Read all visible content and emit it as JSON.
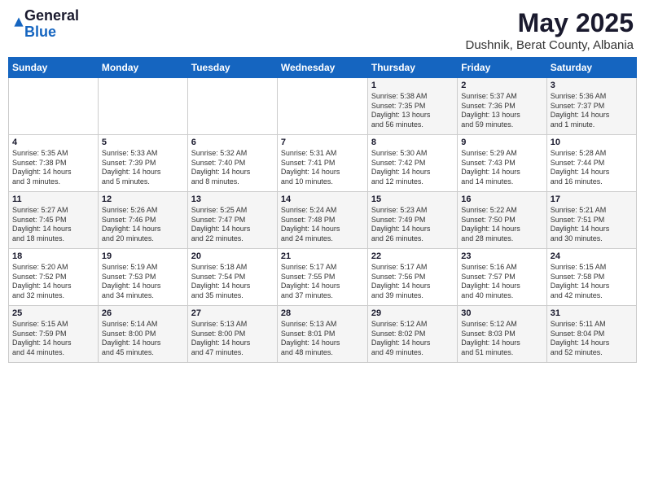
{
  "header": {
    "logo_general": "General",
    "logo_blue": "Blue",
    "month_year": "May 2025",
    "location": "Dushnik, Berat County, Albania"
  },
  "calendar": {
    "days_of_week": [
      "Sunday",
      "Monday",
      "Tuesday",
      "Wednesday",
      "Thursday",
      "Friday",
      "Saturday"
    ],
    "weeks": [
      [
        {
          "day": "",
          "info": ""
        },
        {
          "day": "",
          "info": ""
        },
        {
          "day": "",
          "info": ""
        },
        {
          "day": "",
          "info": ""
        },
        {
          "day": "1",
          "info": "Sunrise: 5:38 AM\nSunset: 7:35 PM\nDaylight: 13 hours\nand 56 minutes."
        },
        {
          "day": "2",
          "info": "Sunrise: 5:37 AM\nSunset: 7:36 PM\nDaylight: 13 hours\nand 59 minutes."
        },
        {
          "day": "3",
          "info": "Sunrise: 5:36 AM\nSunset: 7:37 PM\nDaylight: 14 hours\nand 1 minute."
        }
      ],
      [
        {
          "day": "4",
          "info": "Sunrise: 5:35 AM\nSunset: 7:38 PM\nDaylight: 14 hours\nand 3 minutes."
        },
        {
          "day": "5",
          "info": "Sunrise: 5:33 AM\nSunset: 7:39 PM\nDaylight: 14 hours\nand 5 minutes."
        },
        {
          "day": "6",
          "info": "Sunrise: 5:32 AM\nSunset: 7:40 PM\nDaylight: 14 hours\nand 8 minutes."
        },
        {
          "day": "7",
          "info": "Sunrise: 5:31 AM\nSunset: 7:41 PM\nDaylight: 14 hours\nand 10 minutes."
        },
        {
          "day": "8",
          "info": "Sunrise: 5:30 AM\nSunset: 7:42 PM\nDaylight: 14 hours\nand 12 minutes."
        },
        {
          "day": "9",
          "info": "Sunrise: 5:29 AM\nSunset: 7:43 PM\nDaylight: 14 hours\nand 14 minutes."
        },
        {
          "day": "10",
          "info": "Sunrise: 5:28 AM\nSunset: 7:44 PM\nDaylight: 14 hours\nand 16 minutes."
        }
      ],
      [
        {
          "day": "11",
          "info": "Sunrise: 5:27 AM\nSunset: 7:45 PM\nDaylight: 14 hours\nand 18 minutes."
        },
        {
          "day": "12",
          "info": "Sunrise: 5:26 AM\nSunset: 7:46 PM\nDaylight: 14 hours\nand 20 minutes."
        },
        {
          "day": "13",
          "info": "Sunrise: 5:25 AM\nSunset: 7:47 PM\nDaylight: 14 hours\nand 22 minutes."
        },
        {
          "day": "14",
          "info": "Sunrise: 5:24 AM\nSunset: 7:48 PM\nDaylight: 14 hours\nand 24 minutes."
        },
        {
          "day": "15",
          "info": "Sunrise: 5:23 AM\nSunset: 7:49 PM\nDaylight: 14 hours\nand 26 minutes."
        },
        {
          "day": "16",
          "info": "Sunrise: 5:22 AM\nSunset: 7:50 PM\nDaylight: 14 hours\nand 28 minutes."
        },
        {
          "day": "17",
          "info": "Sunrise: 5:21 AM\nSunset: 7:51 PM\nDaylight: 14 hours\nand 30 minutes."
        }
      ],
      [
        {
          "day": "18",
          "info": "Sunrise: 5:20 AM\nSunset: 7:52 PM\nDaylight: 14 hours\nand 32 minutes."
        },
        {
          "day": "19",
          "info": "Sunrise: 5:19 AM\nSunset: 7:53 PM\nDaylight: 14 hours\nand 34 minutes."
        },
        {
          "day": "20",
          "info": "Sunrise: 5:18 AM\nSunset: 7:54 PM\nDaylight: 14 hours\nand 35 minutes."
        },
        {
          "day": "21",
          "info": "Sunrise: 5:17 AM\nSunset: 7:55 PM\nDaylight: 14 hours\nand 37 minutes."
        },
        {
          "day": "22",
          "info": "Sunrise: 5:17 AM\nSunset: 7:56 PM\nDaylight: 14 hours\nand 39 minutes."
        },
        {
          "day": "23",
          "info": "Sunrise: 5:16 AM\nSunset: 7:57 PM\nDaylight: 14 hours\nand 40 minutes."
        },
        {
          "day": "24",
          "info": "Sunrise: 5:15 AM\nSunset: 7:58 PM\nDaylight: 14 hours\nand 42 minutes."
        }
      ],
      [
        {
          "day": "25",
          "info": "Sunrise: 5:15 AM\nSunset: 7:59 PM\nDaylight: 14 hours\nand 44 minutes."
        },
        {
          "day": "26",
          "info": "Sunrise: 5:14 AM\nSunset: 8:00 PM\nDaylight: 14 hours\nand 45 minutes."
        },
        {
          "day": "27",
          "info": "Sunrise: 5:13 AM\nSunset: 8:00 PM\nDaylight: 14 hours\nand 47 minutes."
        },
        {
          "day": "28",
          "info": "Sunrise: 5:13 AM\nSunset: 8:01 PM\nDaylight: 14 hours\nand 48 minutes."
        },
        {
          "day": "29",
          "info": "Sunrise: 5:12 AM\nSunset: 8:02 PM\nDaylight: 14 hours\nand 49 minutes."
        },
        {
          "day": "30",
          "info": "Sunrise: 5:12 AM\nSunset: 8:03 PM\nDaylight: 14 hours\nand 51 minutes."
        },
        {
          "day": "31",
          "info": "Sunrise: 5:11 AM\nSunset: 8:04 PM\nDaylight: 14 hours\nand 52 minutes."
        }
      ]
    ]
  }
}
